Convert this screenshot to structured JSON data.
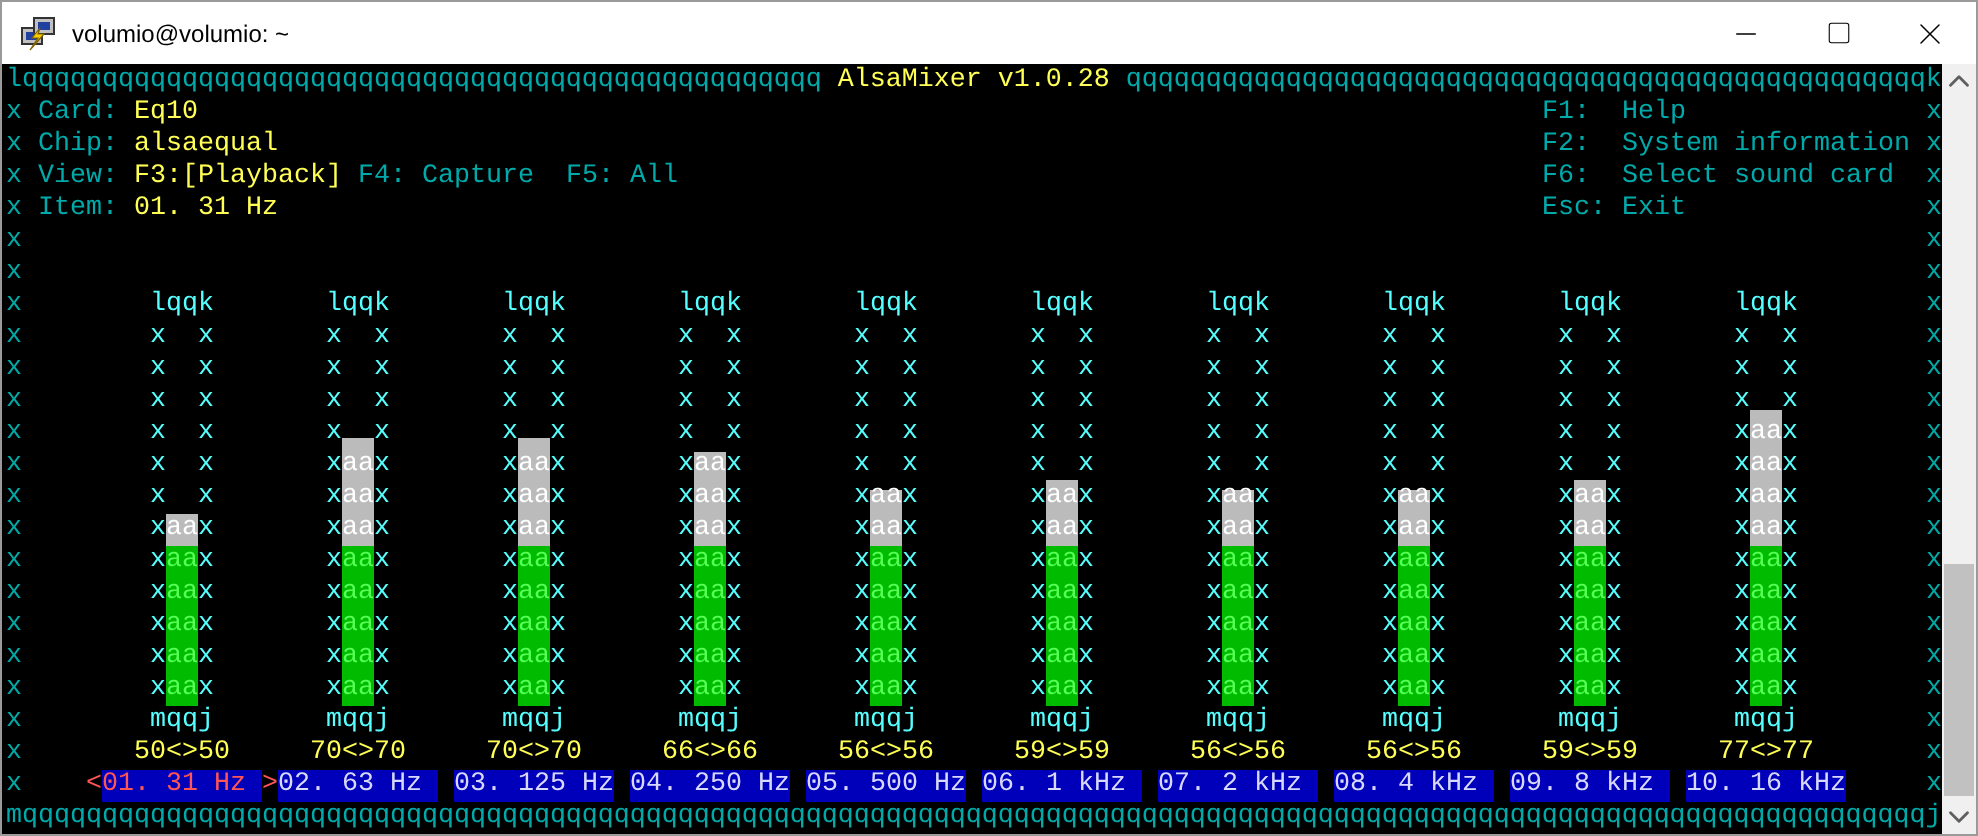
{
  "window": {
    "title": "volumio@volumio: ~"
  },
  "terminal": {
    "frame": {
      "top_left": "lqqqqqqqqqqqqqqqqqqqqqqqqqqqqqqqqqqqqqqqqqqqqqqqqqq",
      "title": "AlsaMixer v1.0.28",
      "top_right": "qqqqqqqqqqqqqqqqqqqqqqqqqqqqqqqqqqqqqqqqqqqqqqqqqqk",
      "bottom": "mqqqqqqqqqqqqqqqqqqqqqqqqqqqqqqqqqqqqqqqqqqqqqqqqqqqqqqqqqqqqqqqqqqqqqqqqqqqqqqqqqqqqqqqqqqqqqqqqqqqqqqqqqqqqqqqqqqqqqqqj",
      "left_side": [
        "x",
        "x",
        "x",
        "x",
        "x",
        "x",
        "x",
        "x",
        "x",
        "x",
        "x",
        "x",
        "x",
        "x",
        "x",
        "x",
        "x",
        "x",
        "x",
        "x",
        "x",
        "x"
      ],
      "right_side": [
        "x",
        "x",
        "x",
        "x",
        "x",
        "x",
        "x",
        "x",
        "x",
        "x",
        "x",
        "x",
        "x",
        "x",
        "x",
        "x",
        "x",
        "x",
        "x",
        "x",
        "x",
        "x"
      ]
    },
    "info": [
      {
        "kind": "text",
        "label": "Card:",
        "value": "Eq10"
      },
      {
        "kind": "text",
        "label": "Chip:",
        "value": "alsaequal"
      },
      {
        "kind": "views",
        "label": "View:",
        "views": [
          {
            "key": "F3:",
            "name": "[Playback]",
            "selected": true
          },
          {
            "key": "F4:",
            "name": "Capture",
            "selected": false
          },
          {
            "key": "F5:",
            "name": "All",
            "selected": false
          }
        ]
      },
      {
        "kind": "text",
        "label": "Item:",
        "value": "01. 31 Hz"
      }
    ],
    "help": [
      {
        "key": "F1:",
        "action": "Help"
      },
      {
        "key": "F2:",
        "action": "System information"
      },
      {
        "key": "F6:",
        "action": "Select sound card"
      },
      {
        "key": "Esc:",
        "action": "Exit"
      }
    ],
    "selection_marks": {
      "left": "<",
      "right": ">"
    },
    "channels": [
      {
        "top": "lqqk",
        "track_rows": [
          {
            "left": "x",
            "right": "x"
          },
          {
            "left": "x",
            "right": "x"
          },
          {
            "left": "x",
            "right": "x"
          },
          {
            "left": "x",
            "right": "x"
          },
          {
            "left": "x",
            "right": "x"
          },
          {
            "left": "x",
            "right": "x"
          },
          {
            "left": "x",
            "right": "x"
          },
          {
            "left": "x",
            "right": "x"
          },
          {
            "left": "x",
            "right": "x"
          },
          {
            "left": "x",
            "right": "x"
          },
          {
            "left": "x",
            "right": "x"
          },
          {
            "left": "x",
            "right": "x"
          }
        ],
        "fill_rows": [
          "aa",
          "aa",
          "aa",
          "aa",
          "aa",
          "aa"
        ],
        "bottom": "mqqj",
        "value": "50<>50",
        "label": "01. 31 Hz",
        "level": 0.5,
        "selected": true
      },
      {
        "top": "lqqk",
        "track_rows": [
          {
            "left": "x",
            "right": "x"
          },
          {
            "left": "x",
            "right": "x"
          },
          {
            "left": "x",
            "right": "x"
          },
          {
            "left": "x",
            "right": "x"
          },
          {
            "left": "x",
            "right": "x"
          },
          {
            "left": "x",
            "right": "x"
          },
          {
            "left": "x",
            "right": "x"
          },
          {
            "left": "x",
            "right": "x"
          },
          {
            "left": "x",
            "right": "x"
          },
          {
            "left": "x",
            "right": "x"
          },
          {
            "left": "x",
            "right": "x"
          },
          {
            "left": "x",
            "right": "x"
          }
        ],
        "fill_rows": [
          "aa",
          "aa",
          "aa",
          "aa",
          "aa",
          "aa",
          "aa",
          "aa"
        ],
        "bottom": "mqqj",
        "value": "70<>70",
        "label": "02. 63 Hz",
        "level": 0.7,
        "selected": false
      },
      {
        "top": "lqqk",
        "track_rows": [
          {
            "left": "x",
            "right": "x"
          },
          {
            "left": "x",
            "right": "x"
          },
          {
            "left": "x",
            "right": "x"
          },
          {
            "left": "x",
            "right": "x"
          },
          {
            "left": "x",
            "right": "x"
          },
          {
            "left": "x",
            "right": "x"
          },
          {
            "left": "x",
            "right": "x"
          },
          {
            "left": "x",
            "right": "x"
          },
          {
            "left": "x",
            "right": "x"
          },
          {
            "left": "x",
            "right": "x"
          },
          {
            "left": "x",
            "right": "x"
          },
          {
            "left": "x",
            "right": "x"
          }
        ],
        "fill_rows": [
          "aa",
          "aa",
          "aa",
          "aa",
          "aa",
          "aa",
          "aa",
          "aa"
        ],
        "bottom": "mqqj",
        "value": "70<>70",
        "label": "03. 125 Hz",
        "level": 0.7,
        "selected": false
      },
      {
        "top": "lqqk",
        "track_rows": [
          {
            "left": "x",
            "right": "x"
          },
          {
            "left": "x",
            "right": "x"
          },
          {
            "left": "x",
            "right": "x"
          },
          {
            "left": "x",
            "right": "x"
          },
          {
            "left": "x",
            "right": "x"
          },
          {
            "left": "x",
            "right": "x"
          },
          {
            "left": "x",
            "right": "x"
          },
          {
            "left": "x",
            "right": "x"
          },
          {
            "left": "x",
            "right": "x"
          },
          {
            "left": "x",
            "right": "x"
          },
          {
            "left": "x",
            "right": "x"
          },
          {
            "left": "x",
            "right": "x"
          }
        ],
        "fill_rows": [
          "aa",
          "aa",
          "aa",
          "aa",
          "aa",
          "aa",
          "aa",
          "aa"
        ],
        "bottom": "mqqj",
        "value": "66<>66",
        "label": "04. 250 Hz",
        "level": 0.66,
        "selected": false
      },
      {
        "top": "lqqk",
        "track_rows": [
          {
            "left": "x",
            "right": "x"
          },
          {
            "left": "x",
            "right": "x"
          },
          {
            "left": "x",
            "right": "x"
          },
          {
            "left": "x",
            "right": "x"
          },
          {
            "left": "x",
            "right": "x"
          },
          {
            "left": "x",
            "right": "x"
          },
          {
            "left": "x",
            "right": "x"
          },
          {
            "left": "x",
            "right": "x"
          },
          {
            "left": "x",
            "right": "x"
          },
          {
            "left": "x",
            "right": "x"
          },
          {
            "left": "x",
            "right": "x"
          },
          {
            "left": "x",
            "right": "x"
          }
        ],
        "fill_rows": [
          "aa",
          "aa",
          "aa",
          "aa",
          "aa",
          "aa",
          "aa"
        ],
        "bottom": "mqqj",
        "value": "56<>56",
        "label": "05. 500 Hz",
        "level": 0.56,
        "selected": false
      },
      {
        "top": "lqqk",
        "track_rows": [
          {
            "left": "x",
            "right": "x"
          },
          {
            "left": "x",
            "right": "x"
          },
          {
            "left": "x",
            "right": "x"
          },
          {
            "left": "x",
            "right": "x"
          },
          {
            "left": "x",
            "right": "x"
          },
          {
            "left": "x",
            "right": "x"
          },
          {
            "left": "x",
            "right": "x"
          },
          {
            "left": "x",
            "right": "x"
          },
          {
            "left": "x",
            "right": "x"
          },
          {
            "left": "x",
            "right": "x"
          },
          {
            "left": "x",
            "right": "x"
          },
          {
            "left": "x",
            "right": "x"
          }
        ],
        "fill_rows": [
          "aa",
          "aa",
          "aa",
          "aa",
          "aa",
          "aa",
          "aa"
        ],
        "bottom": "mqqj",
        "value": "59<>59",
        "label": "06. 1 kHz",
        "level": 0.59,
        "selected": false
      },
      {
        "top": "lqqk",
        "track_rows": [
          {
            "left": "x",
            "right": "x"
          },
          {
            "left": "x",
            "right": "x"
          },
          {
            "left": "x",
            "right": "x"
          },
          {
            "left": "x",
            "right": "x"
          },
          {
            "left": "x",
            "right": "x"
          },
          {
            "left": "x",
            "right": "x"
          },
          {
            "left": "x",
            "right": "x"
          },
          {
            "left": "x",
            "right": "x"
          },
          {
            "left": "x",
            "right": "x"
          },
          {
            "left": "x",
            "right": "x"
          },
          {
            "left": "x",
            "right": "x"
          },
          {
            "left": "x",
            "right": "x"
          }
        ],
        "fill_rows": [
          "aa",
          "aa",
          "aa",
          "aa",
          "aa",
          "aa",
          "aa"
        ],
        "bottom": "mqqj",
        "value": "56<>56",
        "label": "07. 2 kHz",
        "level": 0.56,
        "selected": false
      },
      {
        "top": "lqqk",
        "track_rows": [
          {
            "left": "x",
            "right": "x"
          },
          {
            "left": "x",
            "right": "x"
          },
          {
            "left": "x",
            "right": "x"
          },
          {
            "left": "x",
            "right": "x"
          },
          {
            "left": "x",
            "right": "x"
          },
          {
            "left": "x",
            "right": "x"
          },
          {
            "left": "x",
            "right": "x"
          },
          {
            "left": "x",
            "right": "x"
          },
          {
            "left": "x",
            "right": "x"
          },
          {
            "left": "x",
            "right": "x"
          },
          {
            "left": "x",
            "right": "x"
          },
          {
            "left": "x",
            "right": "x"
          }
        ],
        "fill_rows": [
          "aa",
          "aa",
          "aa",
          "aa",
          "aa",
          "aa",
          "aa"
        ],
        "bottom": "mqqj",
        "value": "56<>56",
        "label": "08. 4 kHz",
        "level": 0.56,
        "selected": false
      },
      {
        "top": "lqqk",
        "track_rows": [
          {
            "left": "x",
            "right": "x"
          },
          {
            "left": "x",
            "right": "x"
          },
          {
            "left": "x",
            "right": "x"
          },
          {
            "left": "x",
            "right": "x"
          },
          {
            "left": "x",
            "right": "x"
          },
          {
            "left": "x",
            "right": "x"
          },
          {
            "left": "x",
            "right": "x"
          },
          {
            "left": "x",
            "right": "x"
          },
          {
            "left": "x",
            "right": "x"
          },
          {
            "left": "x",
            "right": "x"
          },
          {
            "left": "x",
            "right": "x"
          },
          {
            "left": "x",
            "right": "x"
          }
        ],
        "fill_rows": [
          "aa",
          "aa",
          "aa",
          "aa",
          "aa",
          "aa",
          "aa"
        ],
        "bottom": "mqqj",
        "value": "59<>59",
        "label": "09. 8 kHz",
        "level": 0.59,
        "selected": false
      },
      {
        "top": "lqqk",
        "track_rows": [
          {
            "left": "x",
            "right": "x"
          },
          {
            "left": "x",
            "right": "x"
          },
          {
            "left": "x",
            "right": "x"
          },
          {
            "left": "x",
            "right": "x"
          },
          {
            "left": "x",
            "right": "x"
          },
          {
            "left": "x",
            "right": "x"
          },
          {
            "left": "x",
            "right": "x"
          },
          {
            "left": "x",
            "right": "x"
          },
          {
            "left": "x",
            "right": "x"
          },
          {
            "left": "x",
            "right": "x"
          },
          {
            "left": "x",
            "right": "x"
          },
          {
            "left": "x",
            "right": "x"
          }
        ],
        "fill_rows": [
          "aa",
          "aa",
          "aa",
          "aa",
          "aa",
          "aa",
          "aa",
          "aa",
          "aa"
        ],
        "bottom": "mqqj",
        "value": "77<>77",
        "label": "10. 16 kHz",
        "level": 0.77,
        "selected": false
      }
    ]
  }
}
